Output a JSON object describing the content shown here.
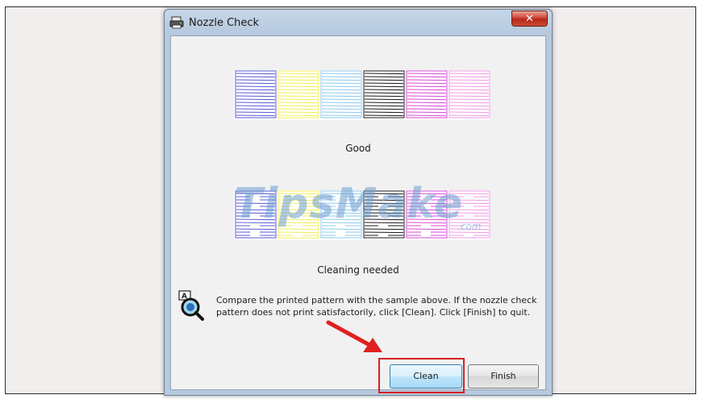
{
  "window": {
    "title": "Nozzle Check",
    "close_glyph": "✕"
  },
  "patterns": {
    "good_label": "Good",
    "bad_label": "Cleaning needed",
    "colors": [
      "#5a5ad6",
      "#f2ee5a",
      "#8ec8ee",
      "#1a1a1a",
      "#d64ad6",
      "#ef9ae6"
    ]
  },
  "watermark": {
    "text": "TipsMake",
    "suffix": ".com"
  },
  "message": {
    "text": "Compare the printed pattern with the sample above. If the nozzle check pattern does not print satisfactorily, click [Clean]. Click [Finish] to quit."
  },
  "buttons": {
    "clean": "Clean",
    "finish": "Finish"
  },
  "icons": {
    "app": "printer-icon",
    "info": "help-magnifier-icon",
    "annotation": "red-arrow"
  },
  "accent": {
    "highlight": "#d62020"
  }
}
